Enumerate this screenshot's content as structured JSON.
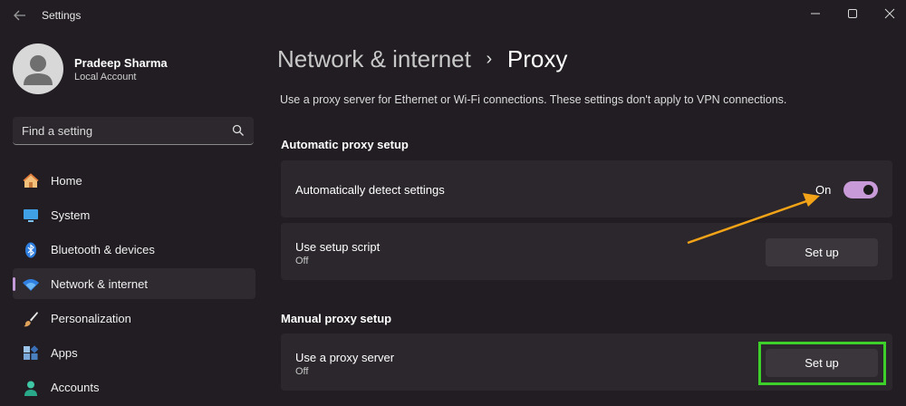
{
  "window": {
    "title": "Settings",
    "back_icon": "back-arrow-icon",
    "controls": [
      "minimize-icon",
      "maximize-icon",
      "close-icon"
    ]
  },
  "profile": {
    "name": "Pradeep Sharma",
    "account_type": "Local Account"
  },
  "search": {
    "placeholder": "Find a setting"
  },
  "sidebar": {
    "items": [
      {
        "label": "Home",
        "icon": "home-icon"
      },
      {
        "label": "System",
        "icon": "monitor-icon"
      },
      {
        "label": "Bluetooth & devices",
        "icon": "bluetooth-icon"
      },
      {
        "label": "Network & internet",
        "icon": "wifi-icon",
        "selected": true
      },
      {
        "label": "Personalization",
        "icon": "paintbrush-icon"
      },
      {
        "label": "Apps",
        "icon": "apps-icon"
      },
      {
        "label": "Accounts",
        "icon": "person-icon"
      }
    ]
  },
  "page": {
    "parent": "Network & internet",
    "separator": "›",
    "title": "Proxy",
    "description": "Use a proxy server for Ethernet or Wi-Fi connections. These settings don't apply to VPN connections."
  },
  "automatic": {
    "heading": "Automatic proxy setup",
    "detect": {
      "label": "Automatically detect settings",
      "state_label": "On",
      "enabled": true
    },
    "script": {
      "label": "Use setup script",
      "status": "Off",
      "button": "Set up"
    }
  },
  "manual": {
    "heading": "Manual proxy setup",
    "proxy_server": {
      "label": "Use a proxy server",
      "status": "Off",
      "button": "Set up"
    }
  },
  "colors": {
    "background": "#211d22",
    "card": "#2b272c",
    "accent": "#c89bd8",
    "annotation_arrow": "#f2a317",
    "annotation_box": "#3ed02a"
  }
}
